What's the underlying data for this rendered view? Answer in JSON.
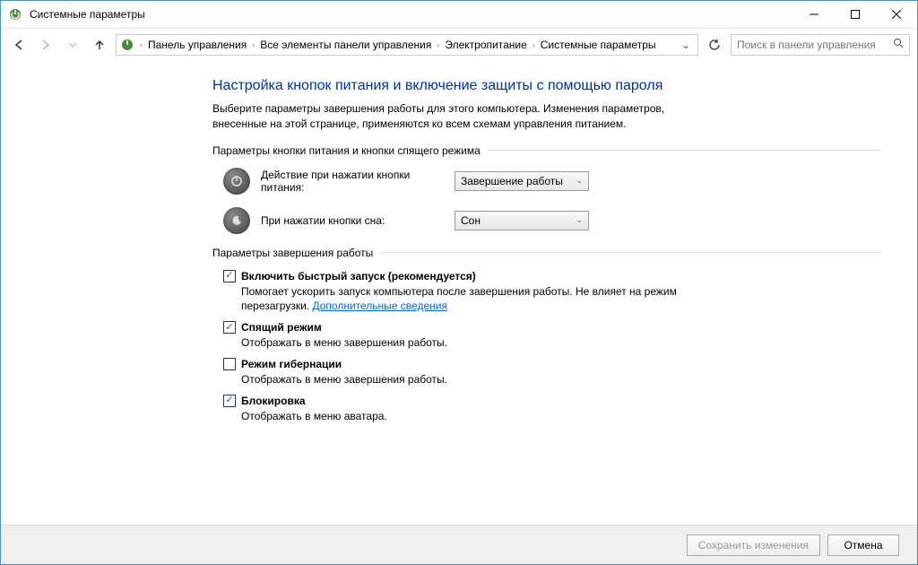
{
  "window": {
    "title": "Системные параметры"
  },
  "breadcrumb": {
    "items": [
      "Панель управления",
      "Все элементы панели управления",
      "Электропитание",
      "Системные параметры"
    ]
  },
  "search": {
    "placeholder": "Поиск в панели управления"
  },
  "main": {
    "heading": "Настройка кнопок питания и включение защиты с помощью пароля",
    "description": "Выберите параметры завершения работы для этого компьютера. Изменения параметров, внесенные на этой странице, применяются ко всем схемам управления питанием.",
    "group1_label": "Параметры кнопки питания и кнопки спящего режима",
    "power_button_label": "Действие при нажатии кнопки питания:",
    "power_button_value": "Завершение работы",
    "sleep_button_label": "При нажатии кнопки сна:",
    "sleep_button_value": "Сон",
    "group2_label": "Параметры завершения работы",
    "checks": [
      {
        "checked": true,
        "label": "Включить быстрый запуск (рекомендуется)",
        "desc_pre": "Помогает ускорить запуск компьютера после завершения работы. Не влияет на режим перезагрузки. ",
        "link": "Дополнительные сведения"
      },
      {
        "checked": true,
        "label": "Спящий режим",
        "desc": "Отображать в меню завершения работы."
      },
      {
        "checked": false,
        "label": "Режим гибернации",
        "desc": "Отображать в меню завершения работы."
      },
      {
        "checked": true,
        "label": "Блокировка",
        "desc": "Отображать в меню аватара."
      }
    ]
  },
  "footer": {
    "save": "Сохранить изменения",
    "cancel": "Отмена"
  }
}
